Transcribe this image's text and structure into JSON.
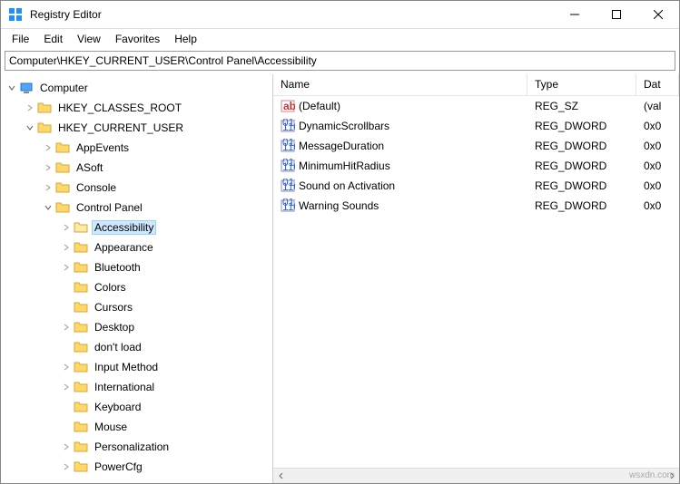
{
  "window": {
    "title": "Registry Editor",
    "minimize": "Minimize",
    "maximize": "Maximize",
    "close": "Close"
  },
  "menu": {
    "file": "File",
    "edit": "Edit",
    "view": "View",
    "favorites": "Favorites",
    "help": "Help"
  },
  "address": "Computer\\HKEY_CURRENT_USER\\Control Panel\\Accessibility",
  "tree": {
    "root": "Computer",
    "hkcr": "HKEY_CLASSES_ROOT",
    "hkcu": "HKEY_CURRENT_USER",
    "appevents": "AppEvents",
    "asoft": "ASoft",
    "console": "Console",
    "controlpanel": "Control Panel",
    "accessibility": "Accessibility",
    "appearance": "Appearance",
    "bluetooth": "Bluetooth",
    "colors": "Colors",
    "cursors": "Cursors",
    "desktop": "Desktop",
    "dontload": "don't load",
    "inputmethod": "Input Method",
    "international": "International",
    "keyboard": "Keyboard",
    "mouse": "Mouse",
    "personalization": "Personalization",
    "powercfg": "PowerCfg"
  },
  "list": {
    "col_name": "Name",
    "col_type": "Type",
    "col_data": "Dat",
    "rows": [
      {
        "name": "(Default)",
        "type": "REG_SZ",
        "data": "(val",
        "kind": "sz"
      },
      {
        "name": "DynamicScrollbars",
        "type": "REG_DWORD",
        "data": "0x0",
        "kind": "bin"
      },
      {
        "name": "MessageDuration",
        "type": "REG_DWORD",
        "data": "0x0",
        "kind": "bin"
      },
      {
        "name": "MinimumHitRadius",
        "type": "REG_DWORD",
        "data": "0x0",
        "kind": "bin"
      },
      {
        "name": "Sound on Activation",
        "type": "REG_DWORD",
        "data": "0x0",
        "kind": "bin"
      },
      {
        "name": "Warning Sounds",
        "type": "REG_DWORD",
        "data": "0x0",
        "kind": "bin"
      }
    ]
  },
  "watermark": "wsxdn.com"
}
